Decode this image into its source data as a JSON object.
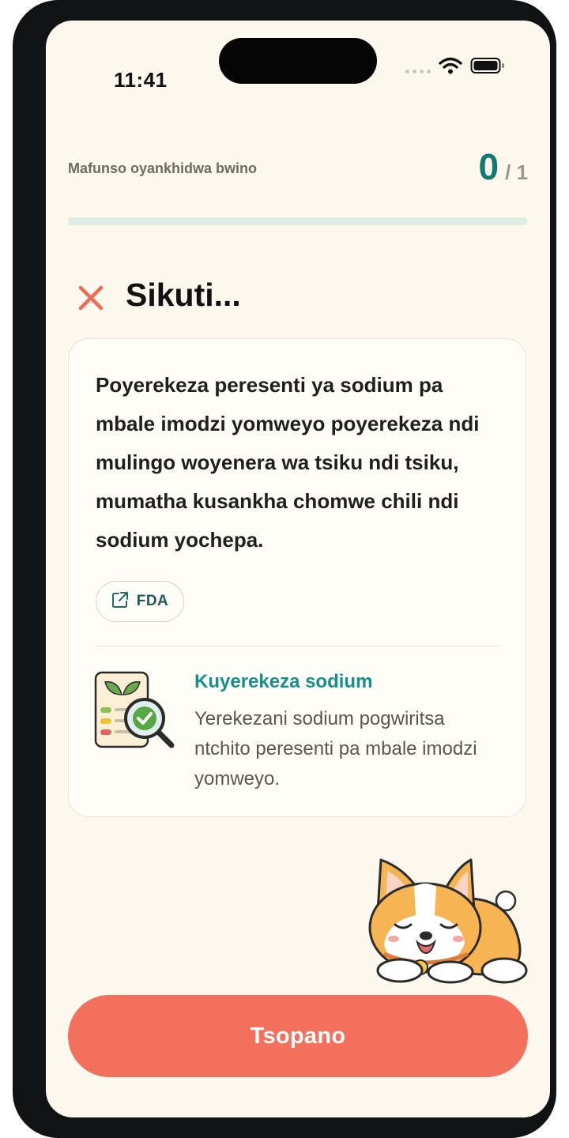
{
  "status_bar": {
    "time": "11:41",
    "icons": [
      "signal-dots-icon",
      "wifi-icon",
      "battery-icon"
    ]
  },
  "progress": {
    "label": "Mafunso oyankhidwa bwino",
    "score": "0",
    "total": "/ 1",
    "fraction_complete": 0
  },
  "result": {
    "icon": "close-icon",
    "title": "Sikuti..."
  },
  "explanation": {
    "text": "Poyerekeza peresenti ya sodium pa mbale imodzi yomweyo poyerekeza ndi mulingo woyenera wa tsiku ndi tsiku, mumatha kusankha chomwe chili ndi sodium yochepa.",
    "source_label": "FDA",
    "source_icon": "external-link-icon"
  },
  "tip": {
    "title": "Kuyerekeza sodium",
    "body": "Yerekezani sodium pogwiritsa ntchito peresenti pa mbale imodzi yomweyo.",
    "illustration": "nutrition-label-magnifier-icon"
  },
  "mascot": "sleeping-corgi-mascot",
  "primary_button": {
    "label": "Tsopano"
  },
  "colors": {
    "background": "#fdf8ee",
    "accent_teal": "#117a70",
    "tip_title": "#13918a",
    "error_red": "#ee6b58",
    "button": "#f2705c",
    "progress_track": "#dfeee4"
  }
}
